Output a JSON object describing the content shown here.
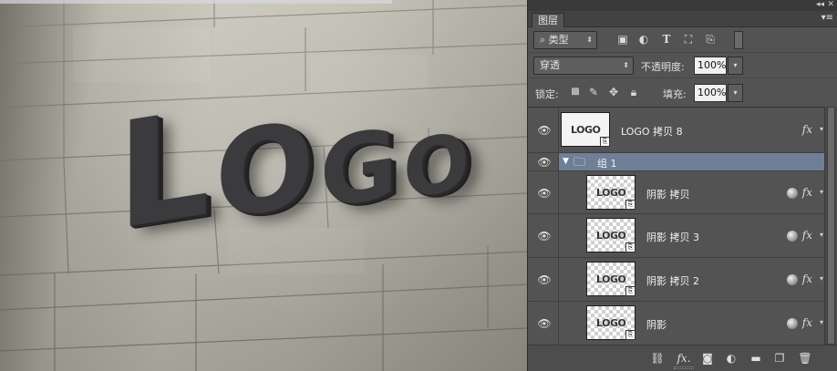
{
  "panel": {
    "title_tab": "图层",
    "menu_icon": "panel-menu-icon",
    "filter": {
      "kind_label": "类型",
      "icons": [
        "image-filter-icon",
        "adjustment-filter-icon",
        "type-filter-icon",
        "shape-filter-icon",
        "smart-object-filter-icon"
      ]
    },
    "blend_mode": "穿透",
    "opacity_label": "不透明度:",
    "opacity_value": "100%",
    "lock_label": "锁定:",
    "fill_label": "填充:",
    "fill_value": "100%"
  },
  "layers": [
    {
      "name": "LOGO 拷贝 8",
      "type": "smart-object",
      "thumb_text": "LOGO",
      "fx": "fx",
      "indented": false
    },
    {
      "name": "组 1",
      "type": "group",
      "expanded": true
    },
    {
      "name": "阴影 拷贝",
      "type": "smart-object",
      "thumb_text": "LOGO",
      "fx": "fx",
      "indented": true
    },
    {
      "name": "阴影 拷贝 3",
      "type": "smart-object",
      "thumb_text": "LOGO",
      "fx": "fx",
      "indented": true
    },
    {
      "name": "阴影 拷贝 2",
      "type": "smart-object",
      "thumb_text": "LOGO",
      "fx": "fx",
      "indented": true
    },
    {
      "name": "阴影",
      "type": "smart-object",
      "thumb_text": "LOGO",
      "fx": "fx",
      "indented": true
    }
  ],
  "canvas": {
    "logo_text": [
      "L",
      "O",
      "G",
      "O"
    ]
  },
  "bottom_icons": [
    "link-icon",
    "fx-icon",
    "mask-icon",
    "adjustment-icon",
    "folder-icon",
    "new-layer-icon",
    "trash-icon"
  ],
  "bottom_fx_label": "fx.",
  "colors": {
    "panel_bg": "#535353",
    "selected_group": "#6f7f98",
    "logo_letters": "#3b3b3d"
  }
}
